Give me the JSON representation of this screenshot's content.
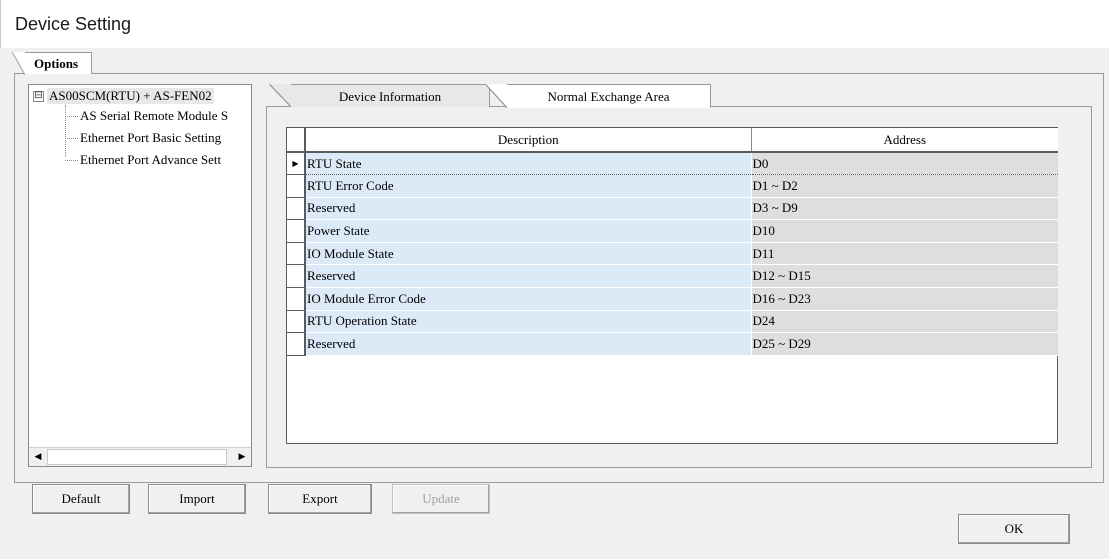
{
  "window": {
    "title": "Device Setting"
  },
  "outer_tab": {
    "label": "Options"
  },
  "tree": {
    "root": {
      "label": "AS00SCM(RTU) + AS-FEN02",
      "expander": "⊟"
    },
    "children": [
      {
        "label": "AS Serial Remote Module S"
      },
      {
        "label": "Ethernet Port Basic Setting"
      },
      {
        "label": "Ethernet Port Advance Sett"
      }
    ],
    "scroll_left": "◀",
    "scroll_right": "▶"
  },
  "tabs": {
    "device_information": "Device Information",
    "normal_exchange_area": "Normal Exchange Area",
    "active": "normal_exchange_area"
  },
  "grid": {
    "columns": {
      "description": "Description",
      "address": "Address"
    },
    "current_row_marker": "▶",
    "rows": [
      {
        "description": "RTU State",
        "address": "D0"
      },
      {
        "description": "RTU Error Code",
        "address": "D1 ~ D2"
      },
      {
        "description": "Reserved",
        "address": "D3 ~ D9"
      },
      {
        "description": "Power State",
        "address": "D10"
      },
      {
        "description": "IO Module State",
        "address": "D11"
      },
      {
        "description": "Reserved",
        "address": "D12 ~ D15"
      },
      {
        "description": "IO Module Error Code",
        "address": "D16 ~ D23"
      },
      {
        "description": "RTU Operation State",
        "address": "D24"
      },
      {
        "description": "Reserved",
        "address": "D25 ~ D29"
      }
    ]
  },
  "buttons": {
    "default": "Default",
    "import": "Import",
    "export": "Export",
    "update": "Update",
    "ok": "OK"
  },
  "colors": {
    "description_cell": "#dce9f7",
    "address_cell": "#dedede",
    "background": "#f0f0f0"
  }
}
